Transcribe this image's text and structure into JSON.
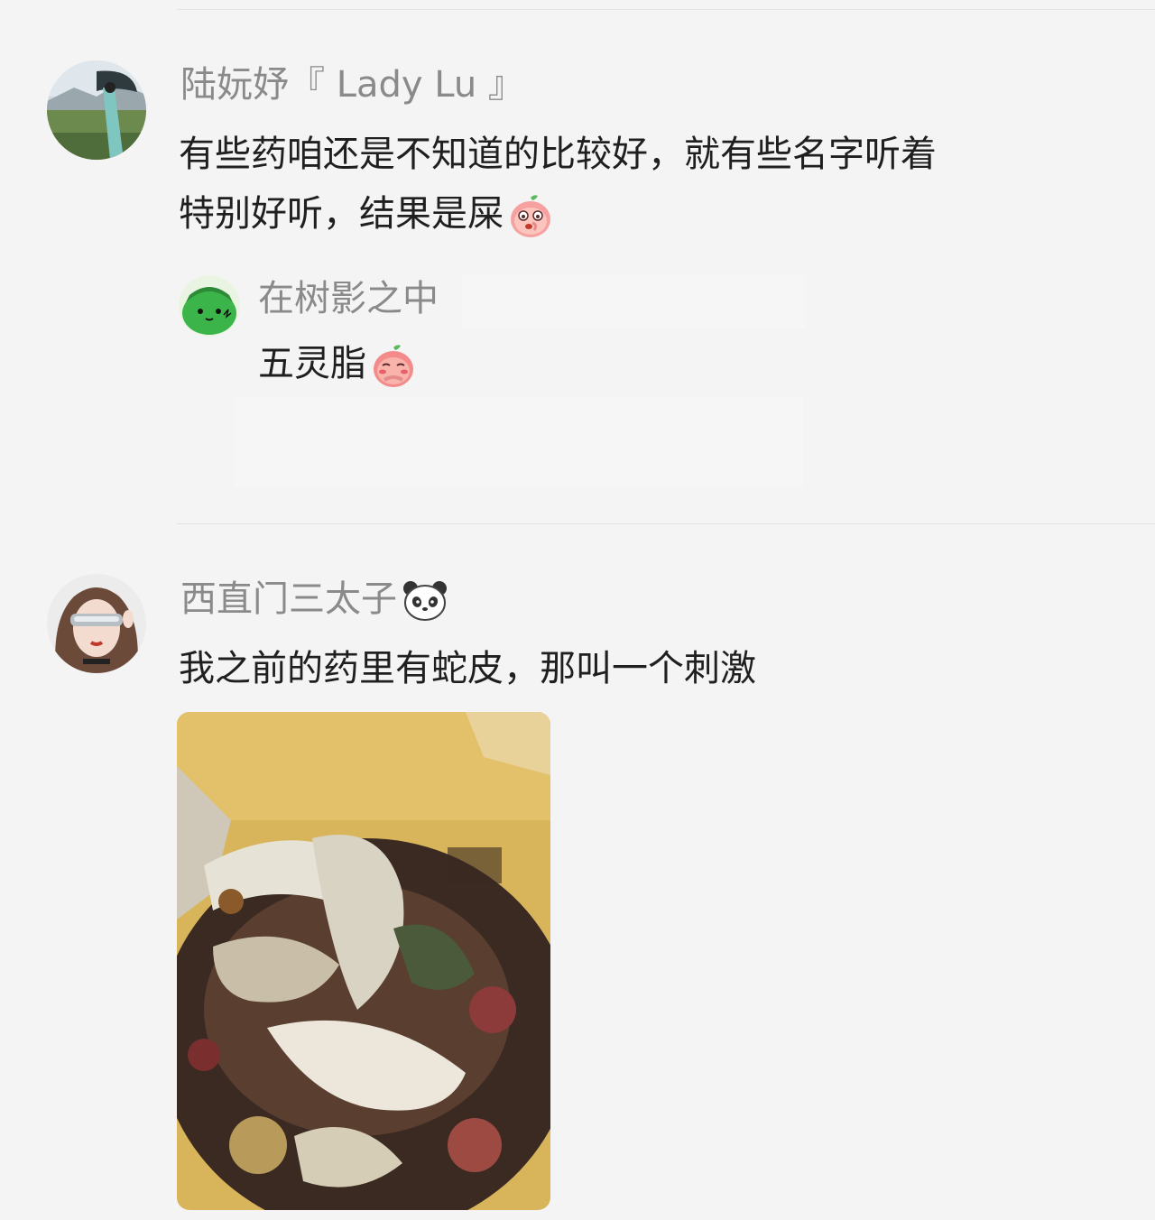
{
  "comments": [
    {
      "username": "陆妧妤『 Lady Lu 』",
      "text_line1": "有些药咱还是不知道的比较好，就有些名字听着",
      "text_line2": "特别好听，结果是屎",
      "avatar_icon": "avatar-person-umbrella-landscape",
      "sticker_icon": "peach-surprised-sticker-icon",
      "reply": {
        "username": "在树影之中",
        "text": "五灵脂",
        "avatar_icon": "avatar-green-frog-cartoon",
        "sticker_icon": "peach-shy-sticker-icon"
      }
    },
    {
      "username": "西直门三太子",
      "username_icon": "panda-icon",
      "text": "我之前的药里有蛇皮，那叫一个刺激",
      "avatar_icon": "avatar-girl-silver-visor",
      "image": {
        "description_icon": "herbal-medicine-photo"
      }
    }
  ],
  "colors": {
    "background": "#f4f4f4",
    "username": "#8a8a8a",
    "text": "#1f1f1f",
    "divider": "#e3e3e3"
  }
}
